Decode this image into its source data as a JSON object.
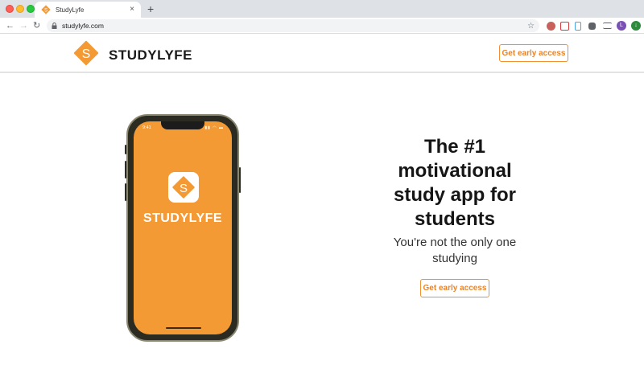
{
  "browser": {
    "tab_title": "StudyLyfe",
    "tab_close": "×",
    "new_tab": "+",
    "url": "studylyfe.com",
    "back": "←",
    "forward": "→",
    "reload": "↻",
    "bookmark": "☆",
    "profile_initial": "L"
  },
  "header": {
    "brand": "STUDYLYFE",
    "logo_letter": "S",
    "cta_label": "Get early access"
  },
  "hero": {
    "phone": {
      "status_time": "9:41",
      "status_icons": "▮▮ ◠ ▬",
      "app_letter": "S",
      "app_name": "STUDYLYFE"
    },
    "headline_line1": "The #1",
    "headline_line2": "motivational",
    "headline_line3": "study app for",
    "headline_line4": "students",
    "subline_line1": "You're not the only one",
    "subline_line2": "studying",
    "cta_label": "Get early access"
  },
  "colors": {
    "brand_orange": "#f39a35",
    "accent": "#e8842a"
  }
}
